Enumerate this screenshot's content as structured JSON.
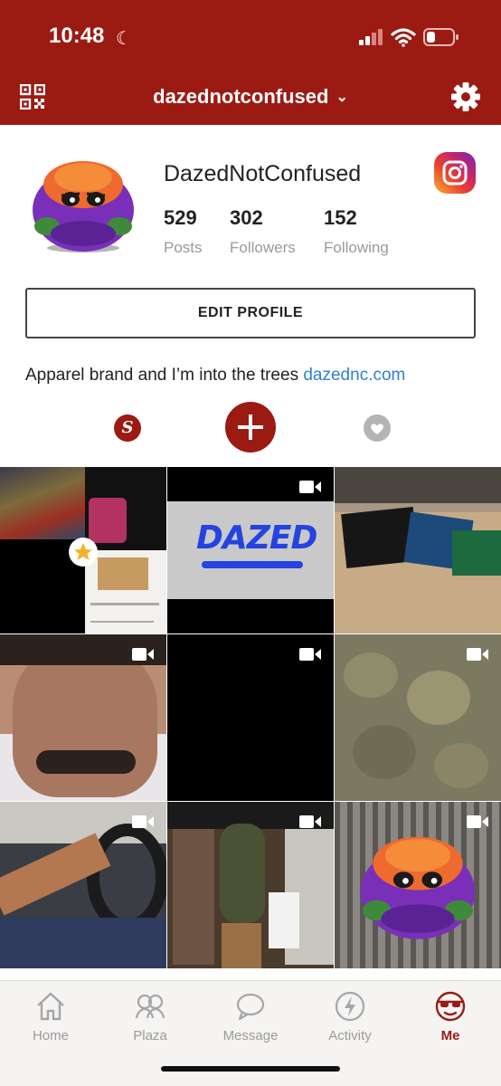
{
  "status_bar": {
    "time": "10:48"
  },
  "header": {
    "account_name": "dazednotconfused"
  },
  "profile": {
    "display_name": "DazedNotConfused",
    "stats": [
      {
        "value": "529",
        "label": "Posts"
      },
      {
        "value": "302",
        "label": "Followers"
      },
      {
        "value": "152",
        "label": "Following"
      }
    ],
    "edit_label": "EDIT PROFILE",
    "bio_text": "Apparel brand and I’m into the trees ",
    "bio_link": "dazednc.com",
    "shop_tab_glyph": "S"
  },
  "grid": {
    "dazed_logo_text": "DAZED",
    "tiles": [
      {
        "content": "collage with product box and pink jacket",
        "starred": true,
        "video": false
      },
      {
        "content": "DAZED logo graphic",
        "video": true
      },
      {
        "content": "clothing merchandise in boxes",
        "video": false
      },
      {
        "content": "selfie close-up",
        "video": true
      },
      {
        "content": "black video frame",
        "video": true
      },
      {
        "content": "cannabis buds",
        "video": true
      },
      {
        "content": "feet in car interior",
        "video": true
      },
      {
        "content": "clothing store interior",
        "video": true
      },
      {
        "content": "mascot character at storefront",
        "video": true
      }
    ]
  },
  "bottom_nav": {
    "items": [
      {
        "label": "Home",
        "icon": "home-icon"
      },
      {
        "label": "Plaza",
        "icon": "plaza-icon"
      },
      {
        "label": "Message",
        "icon": "message-icon"
      },
      {
        "label": "Activity",
        "icon": "activity-icon"
      },
      {
        "label": "Me",
        "icon": "me-icon",
        "active": true
      }
    ]
  },
  "colors": {
    "brand": "#9b1b13",
    "link": "#2f7fd6",
    "muted": "#9a9a9a"
  }
}
